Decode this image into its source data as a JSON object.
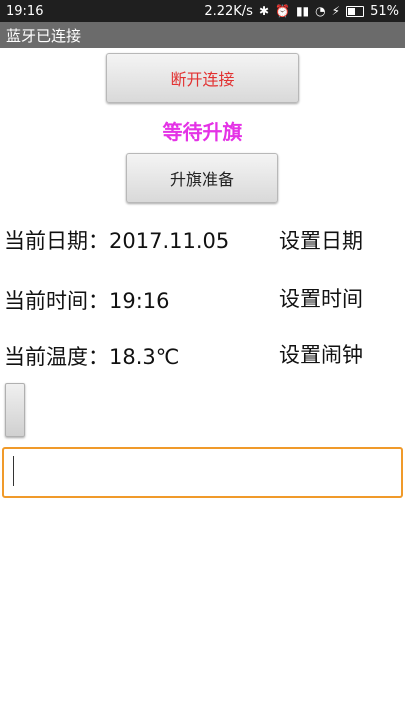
{
  "status_bar": {
    "time": "19:16",
    "network_speed": "2.22K/s",
    "battery": "51%"
  },
  "app": {
    "title": "蓝牙已连接"
  },
  "buttons": {
    "disconnect": "断开连接",
    "prepare": "升旗准备"
  },
  "flag_status": "等待升旗",
  "rows": {
    "date_label": "当前日期：2017.11.05",
    "date_action": "设置日期",
    "time_label": "当前时间：19:16",
    "time_action": "设置时间",
    "temp_label": "当前温度：18.3℃",
    "alarm_action": "设置闹钟"
  },
  "input": {
    "value": ""
  },
  "colors": {
    "disconnect_text": "#e23232",
    "flag_status": "#e432e6",
    "input_focus_border": "#f09a2a",
    "title_bar": "#6b6b6b"
  }
}
